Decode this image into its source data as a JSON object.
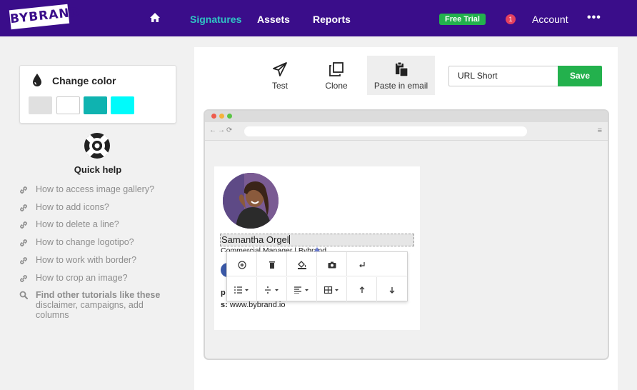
{
  "brand": {
    "logo_text": "BYBRAND"
  },
  "nav": {
    "items": [
      {
        "label": "Signatures",
        "active": true
      },
      {
        "label": "Assets",
        "active": false
      },
      {
        "label": "Reports",
        "active": false
      }
    ],
    "free_trial": "Free Trial",
    "notification_count": "1",
    "account": "Account",
    "more": "•••"
  },
  "sidebar": {
    "change_color_title": "Change color",
    "swatches": [
      "#e0e0e0",
      "#ffffff",
      "#0fb3b0",
      "#00fbfb"
    ],
    "quick_help_title": "Quick help",
    "help_links": [
      "How to access image gallery?",
      "How to add icons?",
      "How to delete a line?",
      "How to change logotipo?",
      "How to work with border?",
      "How to crop an image?"
    ],
    "find_tutorials_bold": "Find other tutorials like these",
    "find_tutorials_rest": "disclaimer, campaigns, add columns"
  },
  "toolbar": {
    "test": "Test",
    "clone": "Clone",
    "paste": "Paste in email",
    "url_value": "URL Short",
    "save": "Save"
  },
  "signature": {
    "name": "Samantha Orgel",
    "title": "Commercial Manager | Bybrand",
    "p_label": "p",
    "s_label": "s:",
    "website": "www.bybrand.io"
  },
  "colors": {
    "nav_bg": "#3a0d8a",
    "accent": "#2fc5c5",
    "green": "#23b14d",
    "badge": "#e5405e"
  }
}
